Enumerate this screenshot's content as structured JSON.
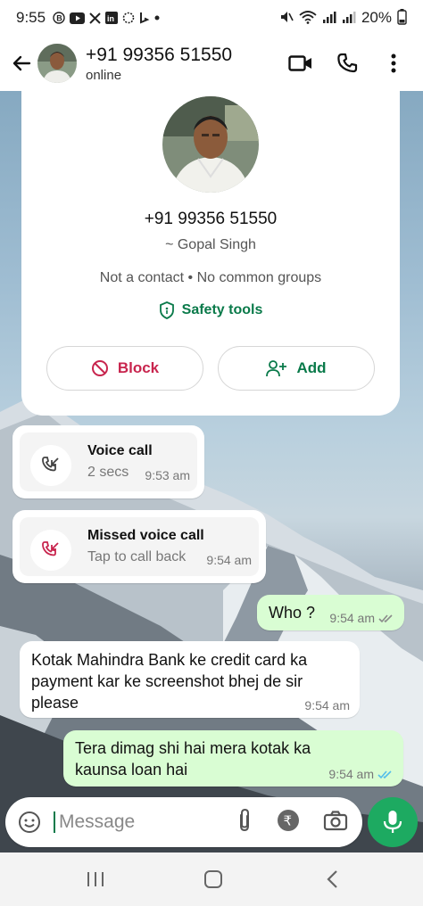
{
  "status_bar": {
    "time": "9:55",
    "battery": "20%",
    "notification_icons": [
      "b-circle-icon",
      "youtube-icon",
      "x-icon",
      "linkedin-icon",
      "sync-icon",
      "bing-icon",
      "dot-icon"
    ]
  },
  "header": {
    "contact_name": "+91 99356 51550",
    "status": "online"
  },
  "profile_card": {
    "phone": "+91 99356 51550",
    "name": "~ Gopal Singh",
    "meta": "Not a contact • No common groups",
    "safety_label": "Safety tools",
    "block_label": "Block",
    "add_label": "Add"
  },
  "messages": [
    {
      "type": "call",
      "direction": "in",
      "title": "Voice call",
      "subtitle": "2 secs",
      "time": "9:53 am"
    },
    {
      "type": "call",
      "direction": "in",
      "title": "Missed voice call",
      "subtitle": "Tap to call back",
      "time": "9:54 am"
    },
    {
      "type": "text",
      "direction": "out",
      "text": "Who ?",
      "time": "9:54 am",
      "ticks": "read-grey"
    },
    {
      "type": "text",
      "direction": "in",
      "text": "Kotak Mahindra Bank ke credit card ka payment kar ke screenshot bhej de sir please",
      "time": "9:54 am"
    },
    {
      "type": "text",
      "direction": "out",
      "text": "Tera dimag shi hai mera kotak ka kaunsa loan hai",
      "time": "9:54 am",
      "ticks": "read-blue"
    }
  ],
  "input": {
    "placeholder": "Message"
  },
  "colors": {
    "brand_green": "#1daa61",
    "accent_dark_green": "#0a7a4a",
    "block_red": "#c8254e",
    "outgoing_bubble": "#d9fdd3",
    "read_tick_blue": "#53bdeb"
  }
}
